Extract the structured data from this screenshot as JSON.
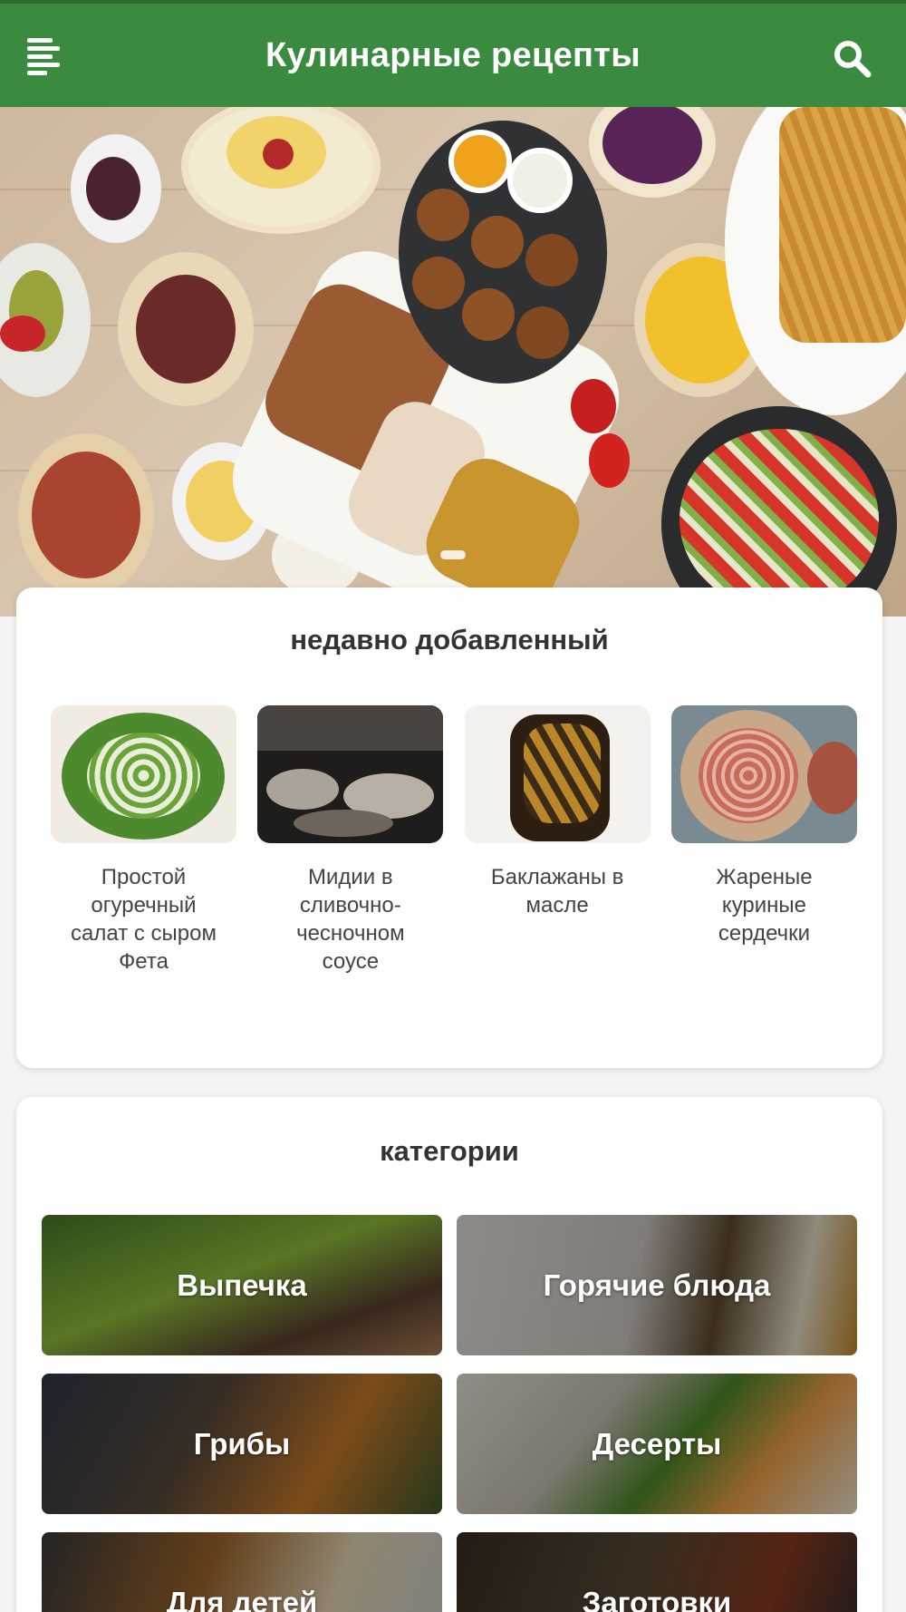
{
  "appbar": {
    "title": "Кулинарные рецепты",
    "menu_icon": "menu-icon",
    "search_icon": "search-icon",
    "color": "#3a8a3f"
  },
  "recent": {
    "title": "недавно добавленный",
    "items": [
      {
        "name": "Простой огуречный салат с сыром Фета"
      },
      {
        "name": "Мидии в сливочно-чесночном соусе"
      },
      {
        "name": "Баклажаны в масле"
      },
      {
        "name": "Жареные куриные сердечки"
      }
    ]
  },
  "categories": {
    "title": "категории",
    "items": [
      {
        "label": "Выпечка"
      },
      {
        "label": "Горячие блюда"
      },
      {
        "label": "Грибы"
      },
      {
        "label": "Десерты"
      },
      {
        "label": "Для детей"
      },
      {
        "label": "Заготовки"
      }
    ]
  }
}
